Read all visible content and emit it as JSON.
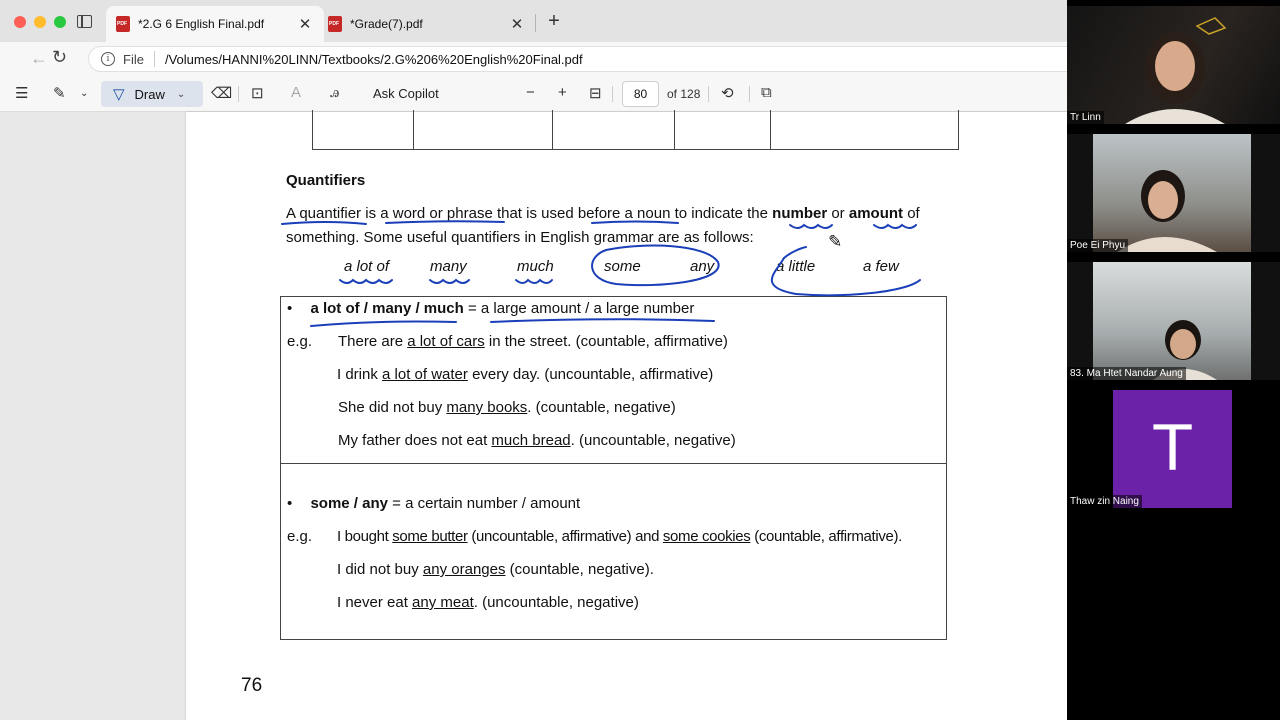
{
  "browser": {
    "tabs": [
      {
        "title": "*2.G 6 English Final.pdf",
        "active": true
      },
      {
        "title": "*Grade(7).pdf",
        "active": false
      }
    ],
    "address": {
      "scheme": "File",
      "url": "/Volumes/HANNI%20LINN/Textbooks/2.G%206%20English%20Final.pdf"
    }
  },
  "pdf_toolbar": {
    "draw_label": "Draw",
    "ask_copilot": "Ask Copilot",
    "page_current": "80",
    "page_total": "of 128",
    "icons": [
      "contents-icon",
      "highlight-icon",
      "draw-pen-icon",
      "eraser-icon",
      "text-box-icon",
      "read-aloud-icon",
      "translate-icon",
      "zoom-out-icon",
      "zoom-in-icon",
      "fit-page-icon",
      "rotate-icon",
      "page-view-icon"
    ]
  },
  "document": {
    "heading": "Quantifiers",
    "para1": {
      "s1": "A quantifier",
      "s2": " is a word or phrase that is used before a noun to indicate the ",
      "s3": "number",
      "s4": " or ",
      "s5": "amount",
      "s6": " of"
    },
    "para2": "something. Some useful quantifiers in English grammar are as follows:",
    "quantifiers": [
      "a lot of",
      "many",
      "much",
      "some",
      "any",
      "a little",
      "a few"
    ],
    "box1": {
      "bullet": "•",
      "term": "a lot of / many / much",
      "definition": " = a large amount / a large number",
      "eg": "e.g.",
      "ex1": {
        "pre": "There are ",
        "u": "a lot of cars",
        "post": " in the street. (countable, affirmative)"
      },
      "ex2": {
        "pre": "I drink ",
        "u": "a lot of water",
        "post": " every day. (uncountable, affirmative)"
      },
      "ex3": {
        "pre": "She did not buy ",
        "u": "many books",
        "post": ". (countable, negative)"
      },
      "ex4": {
        "pre": "My father does not eat ",
        "u": "much bread",
        "post": ". (uncountable, negative)"
      }
    },
    "box2": {
      "bullet": "•",
      "term": "some / any",
      "definition": " = a certain number / amount",
      "eg": "e.g.",
      "ex1": {
        "pre": "I bought ",
        "u1": "some butter",
        "mid": " (uncountable, affirmative) and ",
        "u2": "some cookies",
        "post": " (countable, affirmative)."
      },
      "ex2": {
        "pre": "I did not buy ",
        "u": "any oranges",
        "post": " (countable, negative)."
      },
      "ex3": {
        "pre": "I never eat ",
        "u": "any meat",
        "post": ". (uncountable, negative)"
      }
    },
    "page_number": "76",
    "ink_color": "#1a3fb8"
  },
  "participants": [
    {
      "name": "Tr Linn"
    },
    {
      "name": "Poe Ei Phyu"
    },
    {
      "name": "83. Ma Htet Nandar Aung"
    },
    {
      "name": "Thaw zin Naing",
      "initial": "T",
      "avatar_color": "#6b22a8"
    }
  ]
}
